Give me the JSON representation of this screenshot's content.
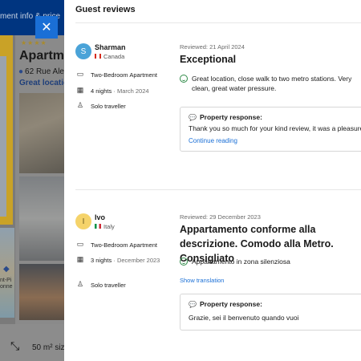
{
  "background": {
    "topbar_text": "ment info & price",
    "stars": "★★★★",
    "property_title": "Apartme",
    "address": "62 Rue Alex",
    "tagline": "Great location",
    "map_text": "nt-Pi\nonne",
    "size_text": "50 m² size",
    "close_label": "✕"
  },
  "panel": {
    "title": "Guest reviews",
    "reviews": [
      {
        "avatar_initial": "S",
        "name": "Sharman",
        "country": "Canada",
        "room": "Two-Bedroom Apartment",
        "stay_nights": "4 nights",
        "stay_date": "March 2024",
        "traveller": "Solo traveller",
        "date": "Reviewed: 21 April 2024",
        "headline": "Exceptional",
        "positive": "Great location, close walk to two metro stations. Very clean, great water pressure.",
        "response_title": "Property response:",
        "response_text": "Thank you so much for your kind review, it was a pleasure",
        "continue_label": "Continue reading"
      },
      {
        "avatar_initial": "I",
        "name": "Ivo",
        "country": "Italy",
        "room": "Two-Bedroom Apartment",
        "stay_nights": "3 nights",
        "stay_date": "December 2023",
        "traveller": "Solo traveller",
        "date": "Reviewed: 29 December 2023",
        "headline": "Appartamento conforme alla descrizione. Comodo alla Metro. Consigliato",
        "positive": "Appartamento in zona silenziosa",
        "translation_label": "Show translation",
        "response_title": "Property response:",
        "response_text": "Grazie, sei il benvenuto quando vuoi"
      }
    ]
  },
  "icons": {
    "close": "close-icon",
    "bed": "bed-icon",
    "calendar": "calendar-icon",
    "person": "person-icon",
    "smile": "smile-icon",
    "speech": "speech-bubble-icon",
    "size": "size-icon",
    "pin": "location-pin-icon"
  },
  "colors": {
    "brand_blue": "#003580",
    "accent_blue": "#1a6fd6",
    "positive_green": "#2e8a47",
    "avatar_blue": "#4aa3d8",
    "avatar_yellow": "#f5d36a"
  }
}
